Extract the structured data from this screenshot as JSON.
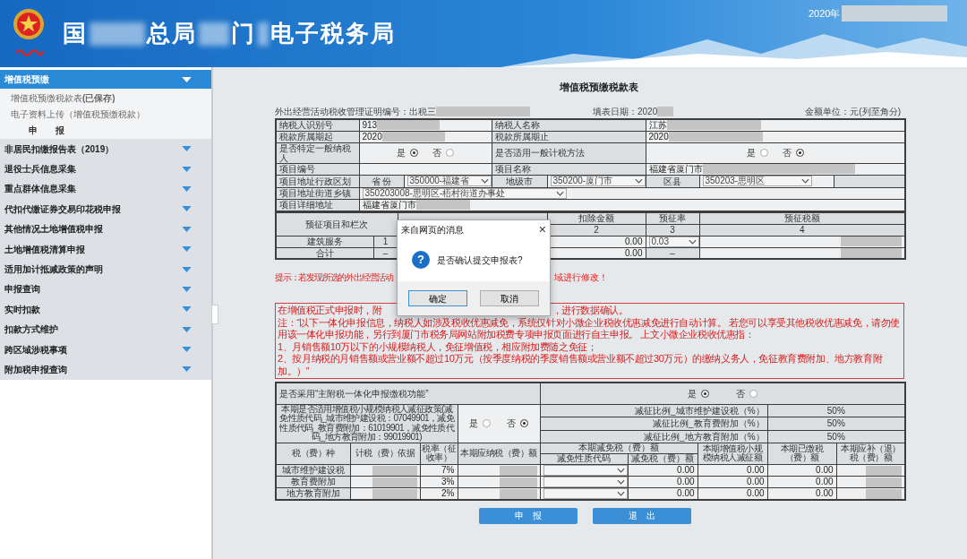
{
  "header": {
    "title_parts": [
      "国",
      "总局",
      "门",
      "电子税务局"
    ],
    "date": "2020年"
  },
  "sidebar": {
    "sections": [
      {
        "label": "增值税预缴",
        "expanded": true,
        "children": [
          {
            "kind": "link",
            "label": "增值税预缴税款表**(已保存)**"
          },
          {
            "kind": "link",
            "label": "电子资料上传（增值税预缴税款）"
          },
          {
            "kind": "action",
            "label": "申　　报"
          }
        ]
      },
      {
        "label": "非居民扣缴报告表（2019）",
        "expanded": false
      },
      {
        "label": "退役士兵信息采集",
        "expanded": false
      },
      {
        "label": "重点群体信息采集",
        "expanded": false
      },
      {
        "label": "代扣代缴证券交易印花税申报",
        "expanded": false
      },
      {
        "label": "其他情况土地增值税申报",
        "expanded": false
      },
      {
        "label": "土地增值税清算申报",
        "expanded": false
      },
      {
        "label": "适用加计抵减政策的声明",
        "expanded": false
      },
      {
        "label": "申报查询",
        "expanded": false
      },
      {
        "label": "实时扣款",
        "expanded": false
      },
      {
        "label": "扣款方式维护",
        "expanded": false
      },
      {
        "label": "跨区域涉税事项",
        "expanded": false
      },
      {
        "label": "附加税申报查询",
        "expanded": false
      }
    ]
  },
  "form": {
    "title": "增值税预缴税款表",
    "certificate_label": "外出经营活动税收管理证明编号：",
    "certificate_value": "出税三",
    "fill_date_label": "填表日期：",
    "fill_date_value": "2020",
    "unit": "金额单位：元(列至角分)",
    "basic_info": [
      {
        "kind": "text",
        "label": "纳税人识别号",
        "value": "913",
        "masked": true
      },
      {
        "kind": "text",
        "label": "纳税人名称",
        "value": "江苏",
        "masked": true
      },
      {
        "kind": "text",
        "label": "税款所属期起",
        "value": "2020",
        "masked": true
      },
      {
        "kind": "text",
        "label": "税款所属期止",
        "value": "2020",
        "masked": true
      },
      {
        "kind": "radio",
        "label": "是否特定一般纳税人",
        "options": [
          {
            "label": "是",
            "selected": true
          },
          {
            "label": "否",
            "selected": false
          }
        ]
      },
      {
        "kind": "radio",
        "label": "是否适用一般计税方法",
        "options": [
          {
            "label": "是",
            "selected": false
          },
          {
            "label": "否",
            "selected": true
          }
        ]
      },
      {
        "kind": "text",
        "label": "项目编号"
      },
      {
        "kind": "text",
        "label": "项目名称",
        "value": "福建省厦门市",
        "masked": true
      }
    ],
    "region": {
      "label": "项目地址行政区划",
      "fields": [
        {
          "label": "省 份",
          "value": "350000-福建省"
        },
        {
          "label": "地级市",
          "value": "350200-厦门市"
        },
        {
          "label": "区县",
          "value": "350203-思明区"
        }
      ]
    },
    "street": {
      "label": "项目地址街道乡镇",
      "value": "350203008-思明区-梧村街道办事处"
    },
    "address": {
      "label": "项目详细地址",
      "value": "福建省厦门市",
      "masked": true
    },
    "prepay": {
      "item_header": "预征项目和栏次",
      "headers": [
        "扣除金额",
        "预征率",
        "预征税额"
      ],
      "column_numbers": [
        "2",
        "3",
        "4"
      ],
      "rows": [
        {
          "kind": "data",
          "item": "建筑服务",
          "line": "1",
          "deduction": "0.00",
          "rate": "0.03",
          "masked": true
        },
        {
          "kind": "total",
          "item": "合计",
          "line": "–",
          "deduction": "0.00",
          "rate": "–",
          "masked": true
        }
      ]
    },
    "notice_parts": [
      "提示：若发现所选的外出经营活动",
      "域进行修改！"
    ],
    "red_notice": {
      "first_line_parts": [
        "在增值税正式申报时，附",
        "，进行数据确认。"
      ],
      "lines": [
        "注：“以下一体化申报信息，纳税人如涉及税收优惠减免，系统仅针对小微企业税收优惠减免进行自动计算。 若您可以享受其他税收优惠减免，请勿使用该一体化申报功能，另行到厦门市税务局网站附加税费专项申报页面进行自主申报。 上文小微企业税收优惠指：",
        "1、月销售额10万以下的小规模纳税人，免征增值税，相应附加费随之免征；",
        "2、按月纳税的月销售额或营业额不超过10万元（按季度纳税的季度销售额或营业额不超过30万元）的缴纳义务人，免征教育费附加、地方教育附加。）”"
      ]
    },
    "integrated": {
      "question": "是否采用“主附税一体化申报缴税功能”",
      "options": [
        {
          "label": "是",
          "selected": true
        },
        {
          "label": "否",
          "selected": false
        }
      ]
    },
    "reduction_policy": {
      "text": "本期是否适用增值税小规模纳税人减征政策(减免性质代码_城市维护建设税：07049901，减免性质代码_教育费附加：61019901，减免性质代码_地方教育附加：99019901)",
      "options": [
        {
          "label": "是",
          "selected": false
        },
        {
          "label": "否",
          "selected": true
        }
      ]
    },
    "reduction_ratios": [
      {
        "label": "减征比例_城市维护建设税（%）",
        "value": "50%"
      },
      {
        "label": "减征比例_教育费附加（%）",
        "value": "50%"
      },
      {
        "label": "减征比例_地方教育附加（%）",
        "value": "50%"
      }
    ],
    "fee_table": {
      "headers": [
        "税（费）种",
        "计税（费）依据",
        "税率（征收率）",
        "本期应纳税（费）额",
        "本期减免税（费）额",
        "本期增值税小规模纳税人减征额",
        "本期已缴税（费）额",
        "本期应补（退）税（费）额"
      ],
      "subheaders": [
        "减免性质代码",
        "减免税（费）额"
      ],
      "rows": [
        {
          "name": "城市维护建设税",
          "rate": "7%",
          "reduction": "0.00",
          "small_scale": "0.00",
          "paid": "0.00"
        },
        {
          "name": "教育费附加",
          "rate": "3%",
          "reduction": "0.00",
          "small_scale": "0.00",
          "paid": "0.00"
        },
        {
          "name": "地方教育附加",
          "rate": "2%",
          "reduction": "0.00",
          "small_scale": "0.00",
          "paid": "0.00"
        }
      ]
    },
    "buttons": [
      {
        "label": "申　报"
      },
      {
        "label": "退　出"
      }
    ]
  },
  "dialog": {
    "title": "来自网页的消息",
    "close": "×",
    "icon": "?",
    "message": "是否确认提交申报表?",
    "buttons": [
      {
        "label": "确定",
        "selected": true
      },
      {
        "label": "取消",
        "selected": false
      }
    ]
  }
}
